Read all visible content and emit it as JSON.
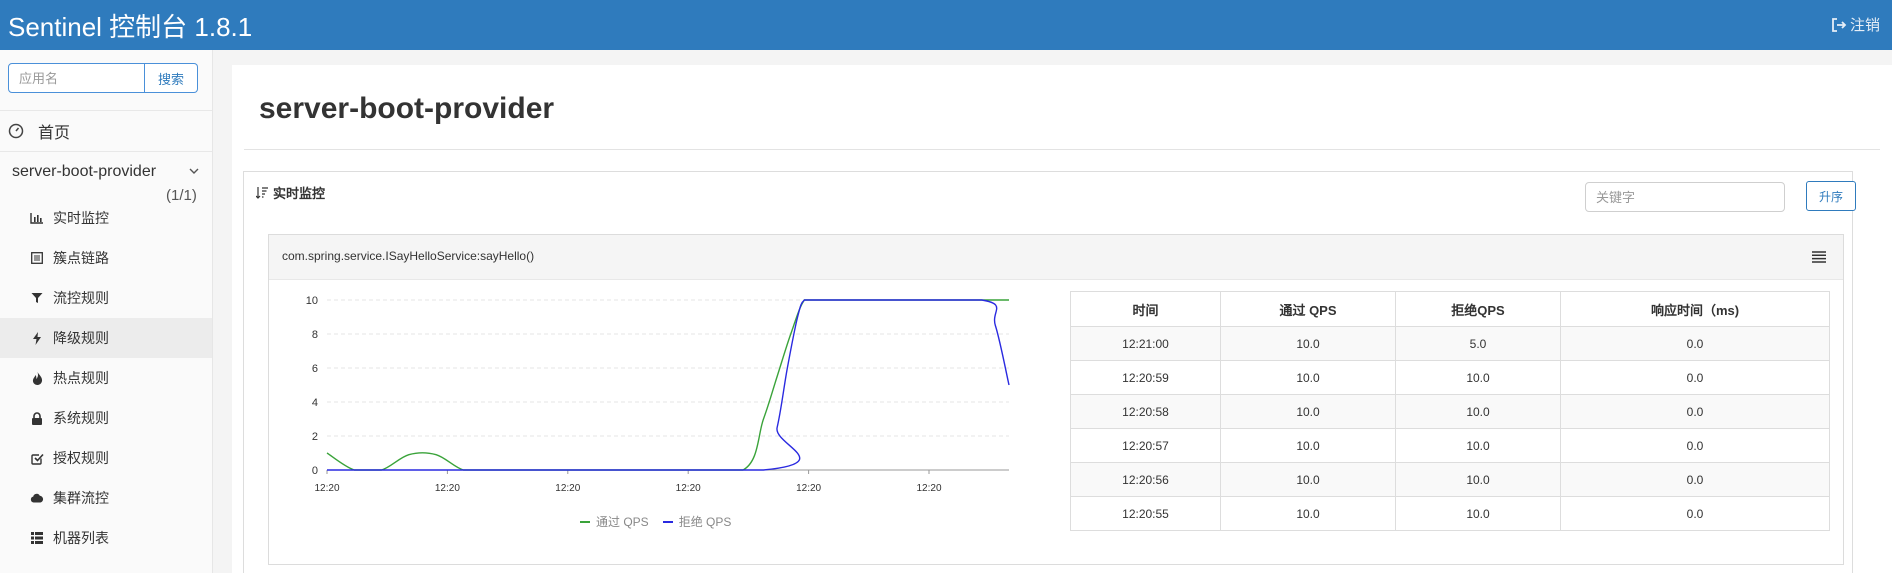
{
  "header": {
    "title": "Sentinel 控制台 1.8.1",
    "logout_label": "注销"
  },
  "sidebar": {
    "search_placeholder": "应用名",
    "search_button": "搜索",
    "home_label": "首页",
    "app_name": "server-boot-provider",
    "app_count": "(1/1)",
    "items": [
      {
        "label": "实时监控",
        "icon": "bar-chart-icon"
      },
      {
        "label": "簇点链路",
        "icon": "list-icon"
      },
      {
        "label": "流控规则",
        "icon": "filter-icon"
      },
      {
        "label": "降级规则",
        "icon": "flash-icon"
      },
      {
        "label": "热点规则",
        "icon": "fire-icon"
      },
      {
        "label": "系统规则",
        "icon": "lock-icon"
      },
      {
        "label": "授权规则",
        "icon": "check-square-icon"
      },
      {
        "label": "集群流控",
        "icon": "cloud-icon"
      },
      {
        "label": "机器列表",
        "icon": "th-list-icon"
      }
    ],
    "active_item": "降级规则"
  },
  "main": {
    "page_title": "server-boot-provider",
    "panel_title": "实时监控",
    "keyword_placeholder": "关键字",
    "sort_button": "升序",
    "resource_name": "com.spring.service.ISayHelloService:sayHello()"
  },
  "chart_data": {
    "type": "line",
    "x_tick_labels": [
      "12:20",
      "12:20",
      "12:20",
      "12:20",
      "12:20",
      "12:20"
    ],
    "ylim": [
      0,
      10
    ],
    "y_ticks": [
      0,
      2,
      4,
      6,
      8,
      10
    ],
    "grid": true,
    "legend_position": "bottom",
    "series": [
      {
        "name": "通过 QPS",
        "color": "#3aa33a",
        "x": [
          0,
          4,
          8,
          12,
          16,
          20,
          24,
          50,
          61,
          64,
          66,
          68,
          70,
          72,
          75,
          100
        ],
        "y": [
          1,
          0,
          0,
          0.9,
          0.9,
          0,
          0,
          0,
          0,
          3,
          5.5,
          8,
          10,
          10,
          10,
          10
        ]
      },
      {
        "name": "拒绝 QPS",
        "color": "#2a2ae0",
        "x": [
          0,
          64,
          66,
          67.5,
          69,
          70,
          72,
          75,
          96,
          98,
          100
        ],
        "y": [
          0,
          0,
          2.5,
          6,
          9,
          10,
          10,
          10,
          10,
          8.5,
          5
        ]
      }
    ]
  },
  "table": {
    "headers": [
      "时间",
      "通过 QPS",
      "拒绝QPS",
      "响应时间（ms)"
    ],
    "rows": [
      [
        "12:21:00",
        "10.0",
        "5.0",
        "0.0"
      ],
      [
        "12:20:59",
        "10.0",
        "10.0",
        "0.0"
      ],
      [
        "12:20:58",
        "10.0",
        "10.0",
        "0.0"
      ],
      [
        "12:20:57",
        "10.0",
        "10.0",
        "0.0"
      ],
      [
        "12:20:56",
        "10.0",
        "10.0",
        "0.0"
      ],
      [
        "12:20:55",
        "10.0",
        "10.0",
        "0.0"
      ]
    ]
  }
}
